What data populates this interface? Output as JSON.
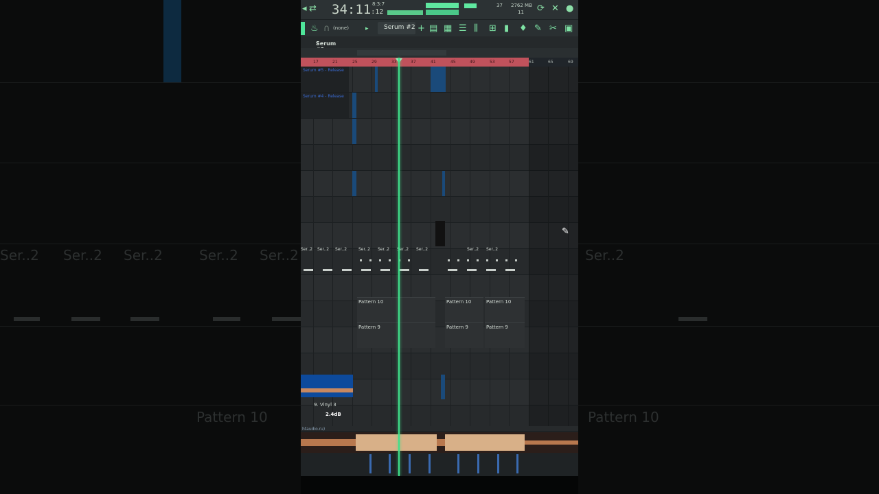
{
  "transport": {
    "time_main": "34:11",
    "time_ticks": ":12",
    "bpm_small": "8:3:7",
    "cpu": "37",
    "memory": "2762 MB",
    "polyphony": "11"
  },
  "toolbar": {
    "snap": "(none)",
    "pattern_name": "Serum #2",
    "add_symbol": "+"
  },
  "channel_header": {
    "name": "Serum #2",
    "arrow": "›"
  },
  "ruler": {
    "bars": [
      "17",
      "21",
      "25",
      "29",
      "33",
      "37",
      "41",
      "45",
      "49",
      "53",
      "57",
      "61",
      "65",
      "69"
    ]
  },
  "clips": {
    "automation_1": "Serum #5 - Release",
    "automation_2": "Serum #4 - Release",
    "ser2_short": "Ser..2",
    "pattern10": "Pattern 10",
    "pattern9": "Pattern 9",
    "vinyl": "9. Vinyl 3",
    "vinyl_vol": "2.4dB",
    "audio_label": "htaudio.ru)"
  },
  "ghost": {
    "ser2": "Ser..2",
    "pattern10": "Pattern 10"
  },
  "colors": {
    "accent": "#3fe08a",
    "loop_region": "#c0525c",
    "clip_blue": "#1a4a7a"
  }
}
